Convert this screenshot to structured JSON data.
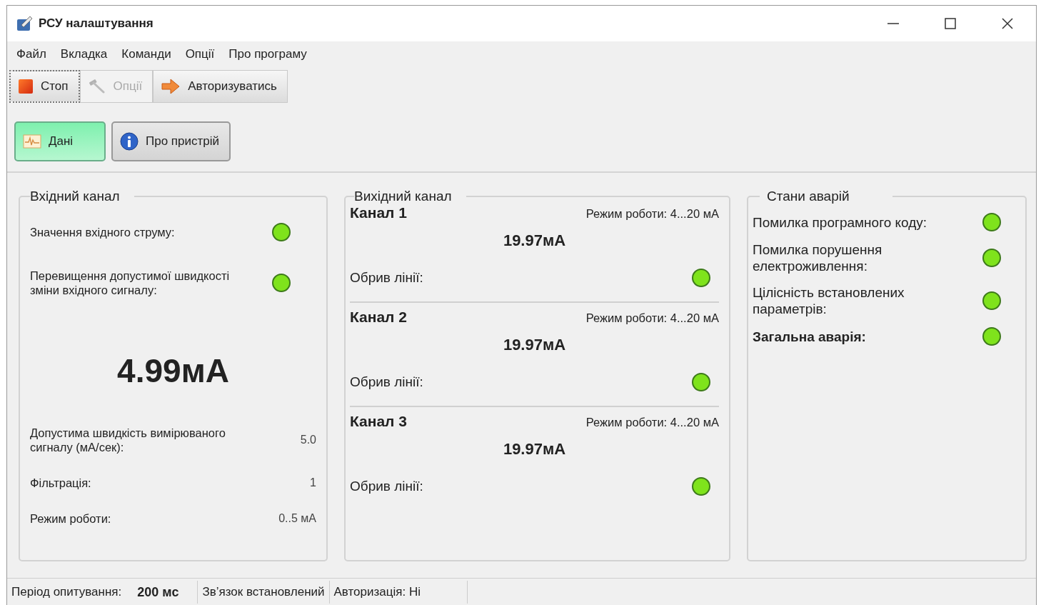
{
  "window": {
    "title": "РСУ налаштування"
  },
  "menu": [
    "Файл",
    "Вкладка",
    "Команди",
    "Опції",
    "Про програму"
  ],
  "toolbar": [
    {
      "label": "Стоп",
      "kind": "stop",
      "disabled": false,
      "focused": true
    },
    {
      "label": "Опції",
      "kind": "options",
      "disabled": true,
      "focused": false
    },
    {
      "label": "Авторизуватись",
      "kind": "login",
      "disabled": false,
      "focused": false
    }
  ],
  "tabs": [
    {
      "label": "Дані",
      "kind": "data",
      "selected": true
    },
    {
      "label": "Про пристрій",
      "kind": "info",
      "selected": false
    }
  ],
  "input_channel": {
    "title": "Вхідний канал",
    "indicators": [
      {
        "label": "Значення вхідного струму:",
        "color": "#7fe31c"
      },
      {
        "label": "Перевищення допустимої швидкості зміни вхідного сигналу:",
        "color": "#7fe31c"
      }
    ],
    "value": "4.99мА",
    "params": [
      {
        "label": "Допустима швидкість вимірюваного сигналу (мА/сек):",
        "value": "5.0"
      },
      {
        "label": "Фільтрація:",
        "value": "1"
      },
      {
        "label": "Режим роботи:",
        "value": "0..5 мА"
      }
    ]
  },
  "output_channel": {
    "title": "Вихідний канал",
    "channels": [
      {
        "name": "Канал 1",
        "mode": "Режим роботи: 4...20 мА",
        "value": "19.97мА",
        "break_label": "Обрив лінії:",
        "color": "#7fe31c"
      },
      {
        "name": "Канал 2",
        "mode": "Режим роботи: 4...20 мА",
        "value": "19.97мА",
        "break_label": "Обрив лінії:",
        "color": "#7fe31c"
      },
      {
        "name": "Канал 3",
        "mode": "Режим роботи: 4...20 мА",
        "value": "19.97мА",
        "break_label": "Обрив лінії:",
        "color": "#7fe31c"
      }
    ]
  },
  "alarms": {
    "title": "Стани аварій",
    "items": [
      {
        "label": "Помилка програмного коду:",
        "bold": false,
        "color": "#7fe31c"
      },
      {
        "label": "Помилка порушення електроживлення:",
        "bold": false,
        "color": "#7fe31c"
      },
      {
        "label": "Цілісність встановлених параметрів:",
        "bold": false,
        "color": "#7fe31c"
      },
      {
        "label": "Загальна аварія:",
        "bold": true,
        "color": "#7fe31c"
      }
    ]
  },
  "status_bar": {
    "poll_label": "Період опитування:",
    "poll_value": "200 мс",
    "connection": "Зв’язок встановлений",
    "auth": "Авторизація: Ні"
  }
}
